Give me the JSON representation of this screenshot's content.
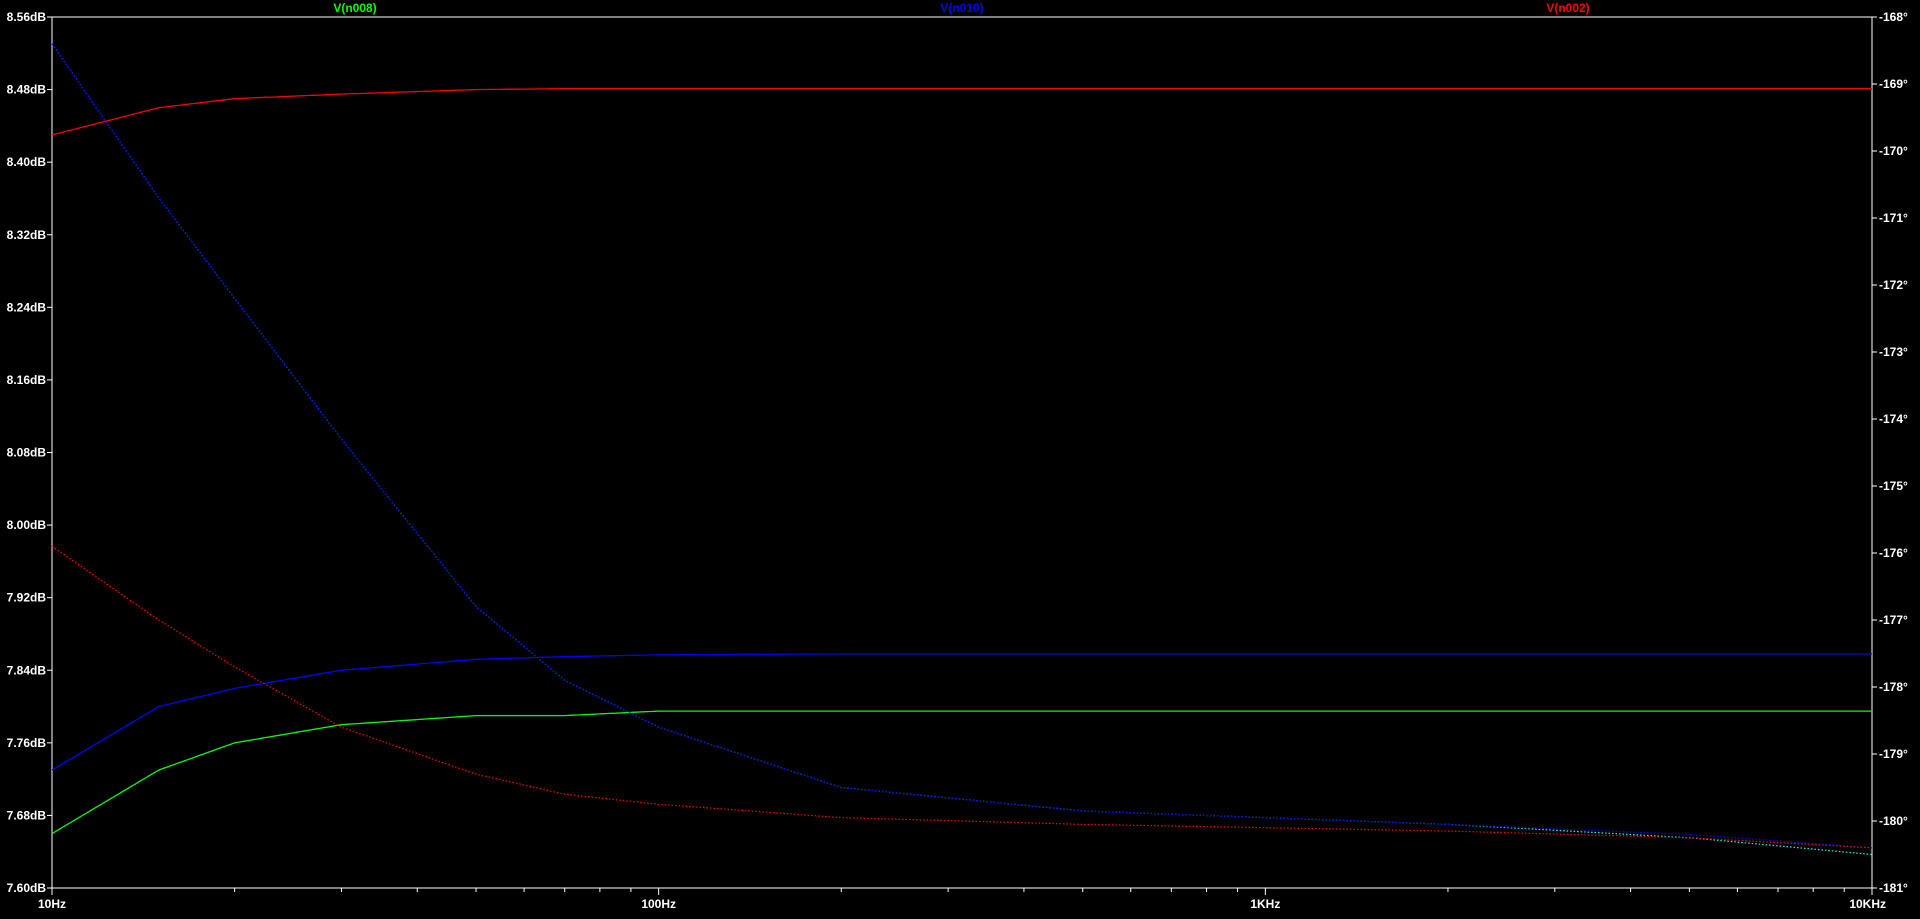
{
  "chart_data": {
    "type": "line",
    "x_scale": "log",
    "xlim": [
      10,
      10000
    ],
    "x_tick_labels": [
      "10Hz",
      "100Hz",
      "1KHz",
      "10KHz"
    ],
    "x_ticks": [
      10,
      100,
      1000,
      10000
    ],
    "y_left": {
      "unit": "dB",
      "ylim": [
        7.6,
        8.56
      ],
      "tick_labels": [
        "8.56dB",
        "8.48dB",
        "8.40dB",
        "8.32dB",
        "8.24dB",
        "8.16dB",
        "8.08dB",
        "8.00dB",
        "7.92dB",
        "7.84dB",
        "7.76dB",
        "7.68dB",
        "7.60dB"
      ],
      "ticks": [
        8.56,
        8.48,
        8.4,
        8.32,
        8.24,
        8.16,
        8.08,
        8.0,
        7.92,
        7.84,
        7.76,
        7.68,
        7.6
      ]
    },
    "y_right": {
      "unit": "°",
      "ylim": [
        -181,
        -168
      ],
      "tick_labels": [
        "-168°",
        "-169°",
        "-170°",
        "-171°",
        "-172°",
        "-173°",
        "-174°",
        "-175°",
        "-176°",
        "-177°",
        "-178°",
        "-179°",
        "-180°",
        "-181°"
      ],
      "ticks": [
        -168,
        -169,
        -170,
        -171,
        -172,
        -173,
        -174,
        -175,
        -176,
        -177,
        -178,
        -179,
        -180,
        -181
      ]
    },
    "legend_placement": "top",
    "grid": false,
    "background": "#000000",
    "axis_color": "#ffffff",
    "series": [
      {
        "name": "V(n008)",
        "color": "#00ff00",
        "phase_color": "#00ffff",
        "magnitude": {
          "x": [
            10,
            15,
            20,
            30,
            50,
            70,
            100,
            200,
            500,
            1000,
            10000
          ],
          "y": [
            7.66,
            7.73,
            7.76,
            7.78,
            7.79,
            7.79,
            7.795,
            7.795,
            7.795,
            7.795,
            7.795
          ]
        },
        "phase": {
          "x": [
            10,
            15,
            20,
            30,
            50,
            70,
            100,
            200,
            500,
            1000,
            2000,
            5000,
            10000
          ],
          "y": [
            -168.4,
            -170.7,
            -172.2,
            -174.3,
            -176.8,
            -177.9,
            -178.6,
            -179.5,
            -179.85,
            -179.95,
            -180.05,
            -180.25,
            -180.5
          ]
        }
      },
      {
        "name": "V(n010)",
        "color": "#0000ff",
        "phase_color": "#0000ff",
        "magnitude": {
          "x": [
            10,
            15,
            20,
            30,
            50,
            70,
            100,
            200,
            500,
            1000,
            10000
          ],
          "y": [
            7.73,
            7.8,
            7.82,
            7.84,
            7.852,
            7.855,
            7.857,
            7.858,
            7.858,
            7.858,
            7.858
          ]
        },
        "phase": {
          "x": [
            10,
            15,
            20,
            30,
            50,
            70,
            100,
            200,
            500,
            1000,
            2000,
            5000,
            10000
          ],
          "y": [
            -168.4,
            -170.7,
            -172.2,
            -174.3,
            -176.8,
            -177.9,
            -178.6,
            -179.5,
            -179.85,
            -179.95,
            -180.05,
            -180.2,
            -180.4
          ]
        }
      },
      {
        "name": "V(n002)",
        "color": "#ff0000",
        "phase_color": "#ff0000",
        "magnitude": {
          "x": [
            10,
            15,
            20,
            30,
            50,
            70,
            100,
            200,
            500,
            1000,
            10000
          ],
          "y": [
            8.43,
            8.46,
            8.47,
            8.475,
            8.48,
            8.481,
            8.481,
            8.481,
            8.481,
            8.481,
            8.481
          ]
        },
        "phase": {
          "x": [
            10,
            15,
            20,
            30,
            50,
            70,
            100,
            200,
            500,
            1000,
            2000,
            5000,
            10000
          ],
          "y": [
            -175.9,
            -177.0,
            -177.7,
            -178.6,
            -179.3,
            -179.6,
            -179.75,
            -179.95,
            -180.05,
            -180.1,
            -180.15,
            -180.25,
            -180.4
          ]
        }
      }
    ]
  }
}
